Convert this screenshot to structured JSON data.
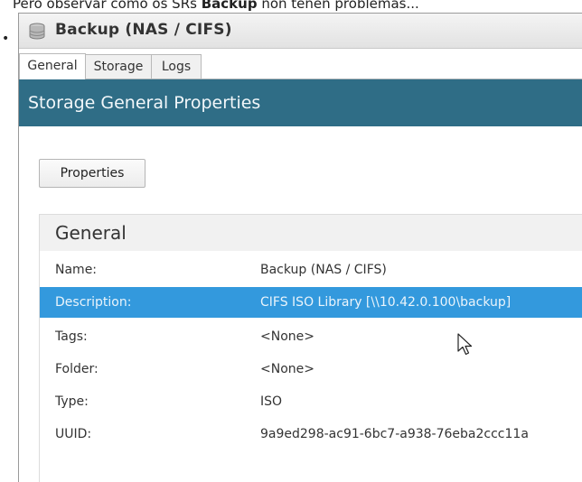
{
  "caption": {
    "before": "Pero observar como os SRs ",
    "bold": "Backup",
    "after": " non teñen problemas..."
  },
  "bullet": "•",
  "window": {
    "title": "Backup (NAS / CIFS)",
    "icon": "database-icon"
  },
  "tabs": [
    {
      "label": "General",
      "active": true
    },
    {
      "label": "Storage",
      "active": false
    },
    {
      "label": "Logs",
      "active": false
    }
  ],
  "header": {
    "title": "Storage General Properties"
  },
  "toolbar": {
    "properties_label": "Properties"
  },
  "general": {
    "title": "General",
    "rows": [
      {
        "label": "Name:",
        "value": "Backup (NAS / CIFS)",
        "selected": false
      },
      {
        "label": "Description:",
        "value": "CIFS ISO Library [\\\\10.42.0.100\\backup]",
        "selected": true
      },
      {
        "label": "Tags:",
        "value": "<None>",
        "selected": false
      },
      {
        "label": "Folder:",
        "value": "<None>",
        "selected": false
      },
      {
        "label": "Type:",
        "value": "ISO",
        "selected": false
      },
      {
        "label": "UUID:",
        "value": "9a9ed298-ac91-6bc7-a938-76eba2ccc11a",
        "selected": false
      }
    ]
  },
  "colors": {
    "header_band": "#2f6d86",
    "selection": "#3399dd"
  }
}
